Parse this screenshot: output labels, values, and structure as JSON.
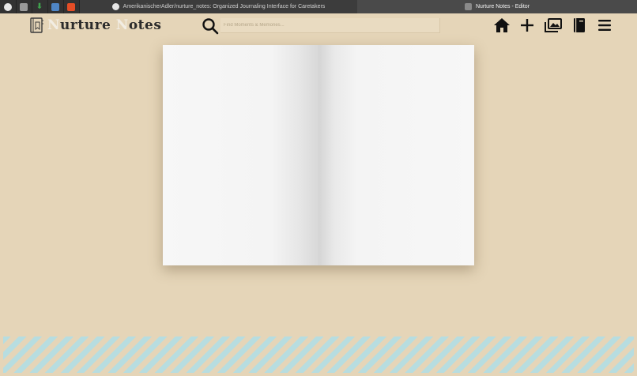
{
  "browser": {
    "pinned_tabs": [
      {
        "icon": "github-icon",
        "color": "#e8e8e8"
      },
      {
        "icon": "cursor-app-icon",
        "color": "#9a9a9a"
      },
      {
        "icon": "download-icon",
        "color": "#3fa34d"
      },
      {
        "icon": "calendar-icon",
        "color": "#4f86c6"
      },
      {
        "icon": "html5-icon",
        "color": "#e44d26"
      }
    ],
    "tabs": [
      {
        "title": "AmerikanischerAdler/nurture_notes: Organized Journaling Interface for Caretakers",
        "icon": "github-icon",
        "active": false
      },
      {
        "title": "Nurture Notes - Editor",
        "icon": "site-icon",
        "active": true
      }
    ]
  },
  "app": {
    "logo": {
      "first_initial": "N",
      "first_rest": "urture ",
      "second_initial": "N",
      "second_rest": "otes"
    },
    "search": {
      "placeholder": "Find Moments & Memories..."
    },
    "nav": [
      {
        "icon": "home-icon",
        "name": "home-button"
      },
      {
        "icon": "plus-icon",
        "name": "new-note-button"
      },
      {
        "icon": "photo-gallery-icon",
        "name": "gallery-button"
      },
      {
        "icon": "notebook-icon",
        "name": "journal-button"
      },
      {
        "icon": "hamburger-menu-icon",
        "name": "menu-button"
      }
    ]
  },
  "colors": {
    "background": "#e5d5b8",
    "accent_stripe": "#b7dde0",
    "page": "#f5f5f5",
    "icon": "#111111"
  }
}
